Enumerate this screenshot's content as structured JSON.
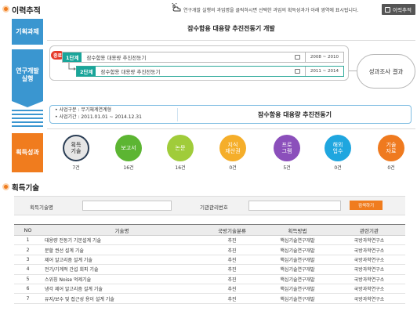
{
  "header": {
    "title": "이력추적",
    "hint": "연구개발 실행의 과업명을 클릭하시면 선택한 과업의 획득성과가 아래 영역에 표시됩니다.",
    "history_button": "이력추적"
  },
  "steps": {
    "task": "기획과제",
    "execution_line1": "연구개발",
    "execution_line2": "실행",
    "outcomes": "획득성과"
  },
  "task_title": "잠수함용 대용량 추진전동기 개발",
  "research": {
    "badge": "종료",
    "stages": [
      {
        "tag": "1단계",
        "name": "잠수함용 대용량 추진전동기",
        "date": "2008 ~ 2010"
      },
      {
        "tag": "2단계",
        "name": "잠수함용 대용량 추진전동기",
        "date": "2011 ~ 2014"
      }
    ],
    "result_label": "성과조사 결과"
  },
  "project_info": {
    "category": "사업구분 : 무기체계연계형",
    "period": "사업기간 : 2011.01.01 ~ 2014.12.31",
    "name": "잠수함용 대용량 추진전동기"
  },
  "outcome_circles": [
    {
      "label1": "획득",
      "label2": "기술",
      "count": "7건",
      "color": "#e6e6e6"
    },
    {
      "label1": "보고서",
      "label2": "",
      "count": "16건",
      "color": "#5cb532"
    },
    {
      "label1": "논문",
      "label2": "",
      "count": "16건",
      "color": "#a0cc3a"
    },
    {
      "label1": "지식",
      "label2": "재산권",
      "count": "0건",
      "color": "#f5ae2a"
    },
    {
      "label1": "프로",
      "label2": "그램",
      "count": "5건",
      "color": "#8b4fbb"
    },
    {
      "label1": "해외",
      "label2": "업수",
      "count": "0건",
      "color": "#1fa6df"
    },
    {
      "label1": "기술",
      "label2": "자료",
      "count": "0건",
      "color": "#ef7a1f"
    }
  ],
  "tech_section": {
    "title": "획득기술",
    "search_label_name": "획득기술명",
    "search_label_org": "기관관리번호",
    "search_name_value": "",
    "search_org_value": "",
    "search_button": "검색하기"
  },
  "table": {
    "headers": [
      "NO",
      "기술명",
      "국방기술분류",
      "획득방법",
      "관련기관"
    ],
    "rows": [
      [
        "1",
        "대용량 전동기 기본설계 기술",
        "추진",
        "핵심기술연구개발",
        "국방과학연구소"
      ],
      [
        "2",
        "분할 권선 설계 기술",
        "추진",
        "핵심기술연구개발",
        "국방과학연구소"
      ],
      [
        "3",
        "제어 알고리즘 설계 기술",
        "추진",
        "핵심기술연구개발",
        "국방과학연구소"
      ],
      [
        "4",
        "전기/기계적 간섭 회피 기술",
        "추진",
        "핵심기술연구개발",
        "국방과학연구소"
      ],
      [
        "5",
        "스위칭 Noise 억제기술",
        "추진",
        "핵심기술연구개발",
        "국방과학연구소"
      ],
      [
        "6",
        "냉각 제어 알고리즘 설계 기술",
        "추진",
        "핵심기술연구개발",
        "국방과학연구소"
      ],
      [
        "7",
        "유지/보수 및 접근성 용이 설계 기술",
        "추진",
        "핵심기술연구개발",
        "국방과학연구소"
      ]
    ]
  }
}
